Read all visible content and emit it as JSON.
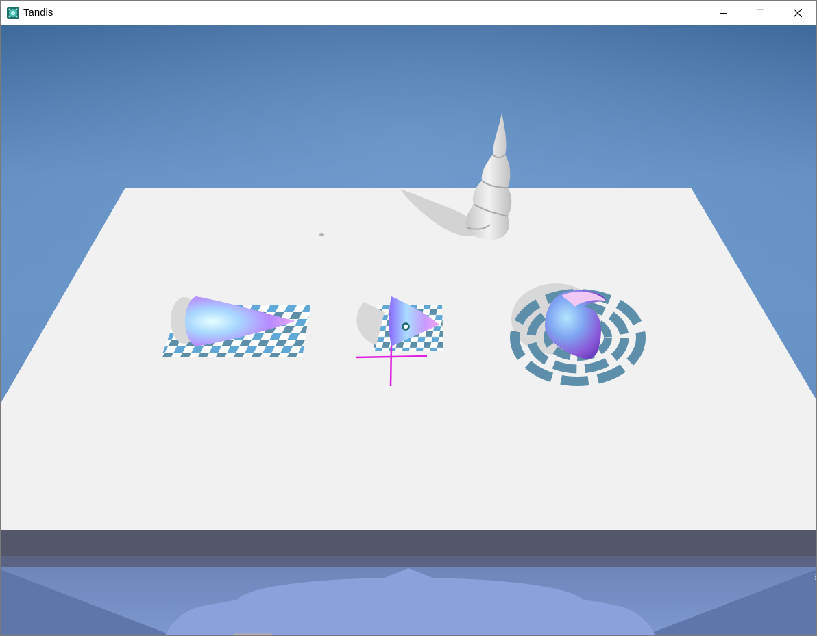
{
  "window": {
    "title": "Tandis",
    "app_icon": "tandis-app-icon",
    "controls": [
      "minimize-icon",
      "maximize-icon",
      "close-icon"
    ]
  },
  "scene": {
    "colors": {
      "sky_top": "#3e6a98",
      "sky_mid": "#6a92c6",
      "table": "#f1f1f1",
      "tile_dark": "#5b8aa6",
      "tile_light": "#5fa8d8",
      "gizmo": "#e020e0",
      "handle": "#1a6b6b"
    },
    "objects": [
      "twisted-horn-sculpture",
      "cone-left",
      "cone-middle",
      "spiral-shell-right"
    ]
  }
}
